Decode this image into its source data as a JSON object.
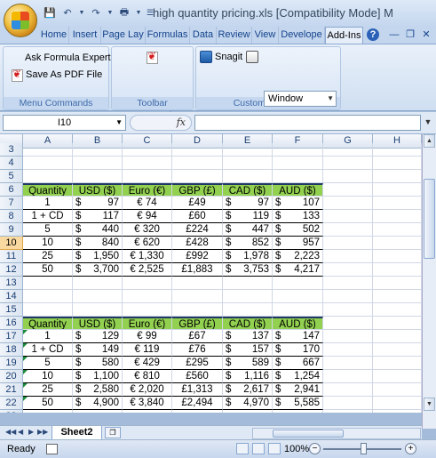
{
  "window": {
    "title": "high quantity pricing.xls  [Compatibility Mode]  M"
  },
  "tabs": [
    "Home",
    "Insert",
    "Page Lay",
    "Formulas",
    "Data",
    "Review",
    "View",
    "Develope",
    "Add-Ins"
  ],
  "active_tab": "Add-Ins",
  "ribbon": {
    "menu_commands": {
      "label": "Menu Commands",
      "items": [
        "Ask Formula Expert",
        "Save As PDF File"
      ]
    },
    "toolbar_commands": {
      "label": "Toolbar Commands"
    },
    "custom_toolbars": {
      "label": "Custom Toolbars",
      "snagit": "Snagit",
      "window_select": "Window"
    }
  },
  "formula_bar": {
    "name_box": "I10",
    "fx": "fx",
    "content": ""
  },
  "columns": [
    "A",
    "B",
    "C",
    "D",
    "E",
    "F",
    "G",
    "H"
  ],
  "rows": [
    "3",
    "4",
    "5",
    "6",
    "7",
    "8",
    "9",
    "10",
    "11",
    "12",
    "13",
    "14",
    "15",
    "16",
    "17",
    "18",
    "19",
    "20",
    "21",
    "22",
    "23"
  ],
  "selected_row": "10",
  "table1": {
    "header": [
      "Quantity",
      "USD ($)",
      "Euro (€)",
      "GBP (£)",
      "CAD ($)",
      "AUD ($)"
    ],
    "rows": [
      {
        "qty": "1",
        "usd": "97",
        "eur": "€ 74",
        "gbp": "£49",
        "cad": "97",
        "aud": "107"
      },
      {
        "qty": "1 + CD",
        "usd": "117",
        "eur": "€ 94",
        "gbp": "£60",
        "cad": "119",
        "aud": "133"
      },
      {
        "qty": "5",
        "usd": "440",
        "eur": "€ 320",
        "gbp": "£224",
        "cad": "447",
        "aud": "502"
      },
      {
        "qty": "10",
        "usd": "840",
        "eur": "€ 620",
        "gbp": "£428",
        "cad": "852",
        "aud": "957"
      },
      {
        "qty": "25",
        "usd": "1,950",
        "eur": "€ 1,330",
        "gbp": "£992",
        "cad": "1,978",
        "aud": "2,223"
      },
      {
        "qty": "50",
        "usd": "3,700",
        "eur": "€ 2,525",
        "gbp": "£1,883",
        "cad": "3,753",
        "aud": "4,217"
      }
    ]
  },
  "table2": {
    "header": [
      "Quantity",
      "USD ($)",
      "Euro (€)",
      "GBP (£)",
      "CAD ($)",
      "AUD ($)"
    ],
    "rows": [
      {
        "qty": "1",
        "usd": "129",
        "eur": "€ 99",
        "gbp": "£67",
        "cad": "137",
        "aud": "147"
      },
      {
        "qty": "1 + CD",
        "usd": "149",
        "eur": "€ 119",
        "gbp": "£76",
        "cad": "157",
        "aud": "170"
      },
      {
        "qty": "5",
        "usd": "580",
        "eur": "€ 429",
        "gbp": "£295",
        "cad": "589",
        "aud": "667"
      },
      {
        "qty": "10",
        "usd": "1,100",
        "eur": "€ 810",
        "gbp": "£560",
        "cad": "1,116",
        "aud": "1,254"
      },
      {
        "qty": "25",
        "usd": "2,580",
        "eur": "€ 2,020",
        "gbp": "£1,313",
        "cad": "2,617",
        "aud": "2,941"
      },
      {
        "qty": "50",
        "usd": "4,900",
        "eur": "€ 3,840",
        "gbp": "£2,494",
        "cad": "4,970",
        "aud": "5,585"
      }
    ]
  },
  "currency_symbol": "$",
  "sheet_tab": "Sheet2",
  "status": {
    "ready": "Ready",
    "zoom": "100%"
  },
  "colors": {
    "header_fill": "#92d050",
    "header_border": "#1f3864",
    "selected_row": "#f9d99f"
  }
}
